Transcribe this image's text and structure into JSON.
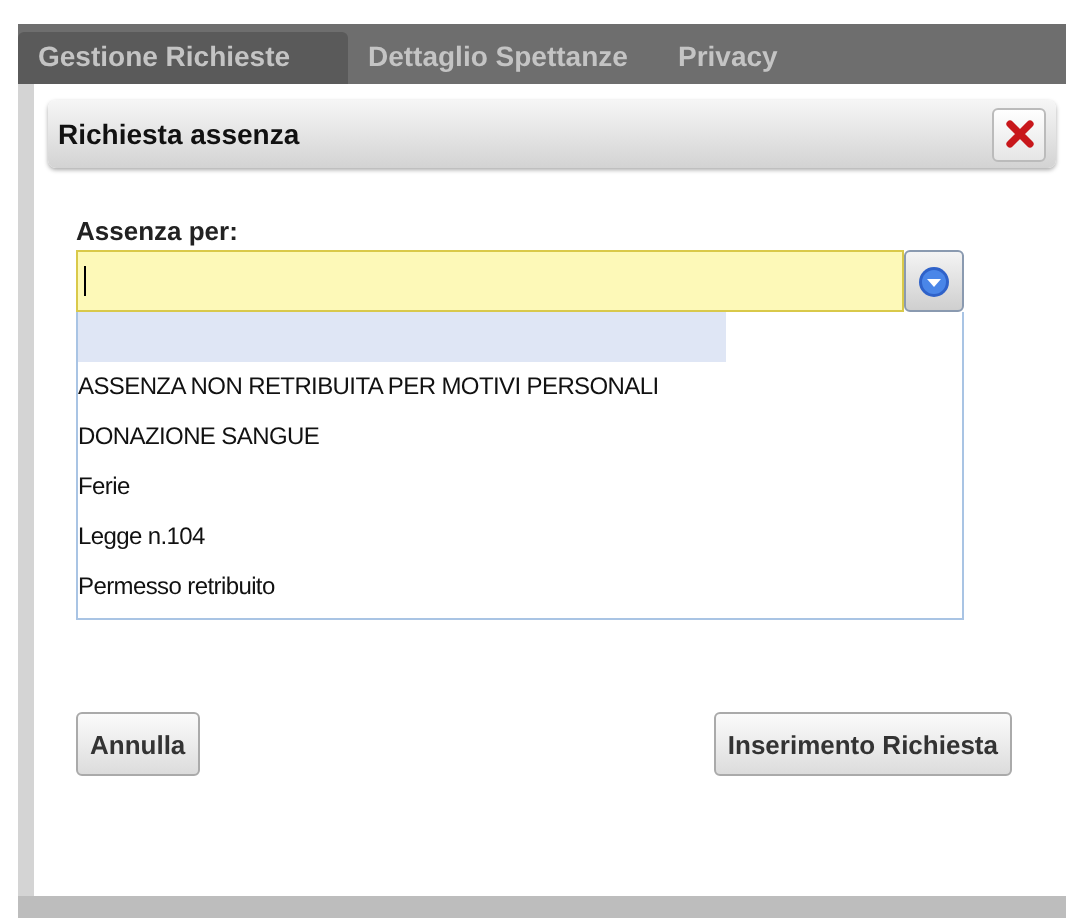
{
  "tabs": [
    {
      "label": "Gestione Richieste",
      "selected": true
    },
    {
      "label": "Dettaglio Spettanze",
      "selected": false
    },
    {
      "label": "Privacy",
      "selected": false
    }
  ],
  "dialog": {
    "title": "Richiesta assenza",
    "field": {
      "label": "Assenza per:"
    },
    "options": [
      {
        "selected": true
      },
      {
        "label": "ASSENZA NON RETRIBUITA PER MOTIVI PERSONALI",
        "selected": false
      },
      {
        "label": "DONAZIONE SANGUE",
        "selected": false
      },
      {
        "label": "Ferie",
        "selected": false
      },
      {
        "label": "Legge n.104",
        "selected": false
      },
      {
        "label": "Permesso retribuito",
        "selected": false
      }
    ],
    "buttons": {
      "cancel": "Annulla",
      "submit": "Inserimento Richiesta"
    }
  }
}
